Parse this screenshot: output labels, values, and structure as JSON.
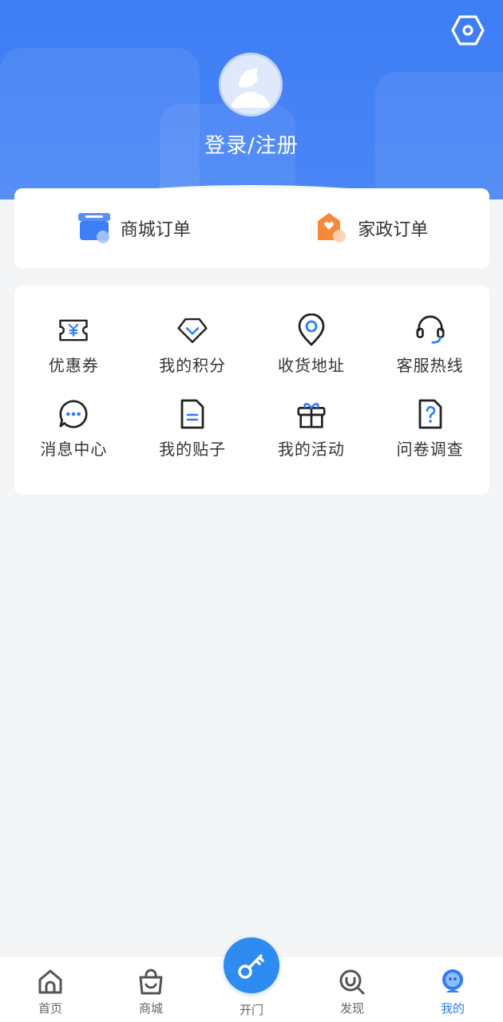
{
  "header": {
    "login_label": "登录/注册"
  },
  "orders": [
    {
      "label": "商城订单",
      "icon": "store-icon"
    },
    {
      "label": "家政订单",
      "icon": "house-heart-icon"
    }
  ],
  "menu": [
    {
      "label": "优惠券",
      "icon": "coupon-icon"
    },
    {
      "label": "我的积分",
      "icon": "diamond-icon"
    },
    {
      "label": "收货地址",
      "icon": "location-icon"
    },
    {
      "label": "客服热线",
      "icon": "headset-icon"
    },
    {
      "label": "消息中心",
      "icon": "message-icon"
    },
    {
      "label": "我的贴子",
      "icon": "document-icon"
    },
    {
      "label": "我的活动",
      "icon": "gift-icon"
    },
    {
      "label": "问卷调查",
      "icon": "questionnaire-icon"
    }
  ],
  "tabbar": [
    {
      "label": "首页",
      "icon": "home-icon"
    },
    {
      "label": "商城",
      "icon": "shopping-bag-icon"
    },
    {
      "label": "开门",
      "icon": "key-icon"
    },
    {
      "label": "发现",
      "icon": "discover-icon"
    },
    {
      "label": "我的",
      "icon": "profile-icon",
      "active": true
    }
  ],
  "colors": {
    "header_blue": "#3d7df5",
    "accent_blue": "#2e7cf6",
    "order_orange": "#f5893a",
    "background": "#f4f5f7"
  }
}
